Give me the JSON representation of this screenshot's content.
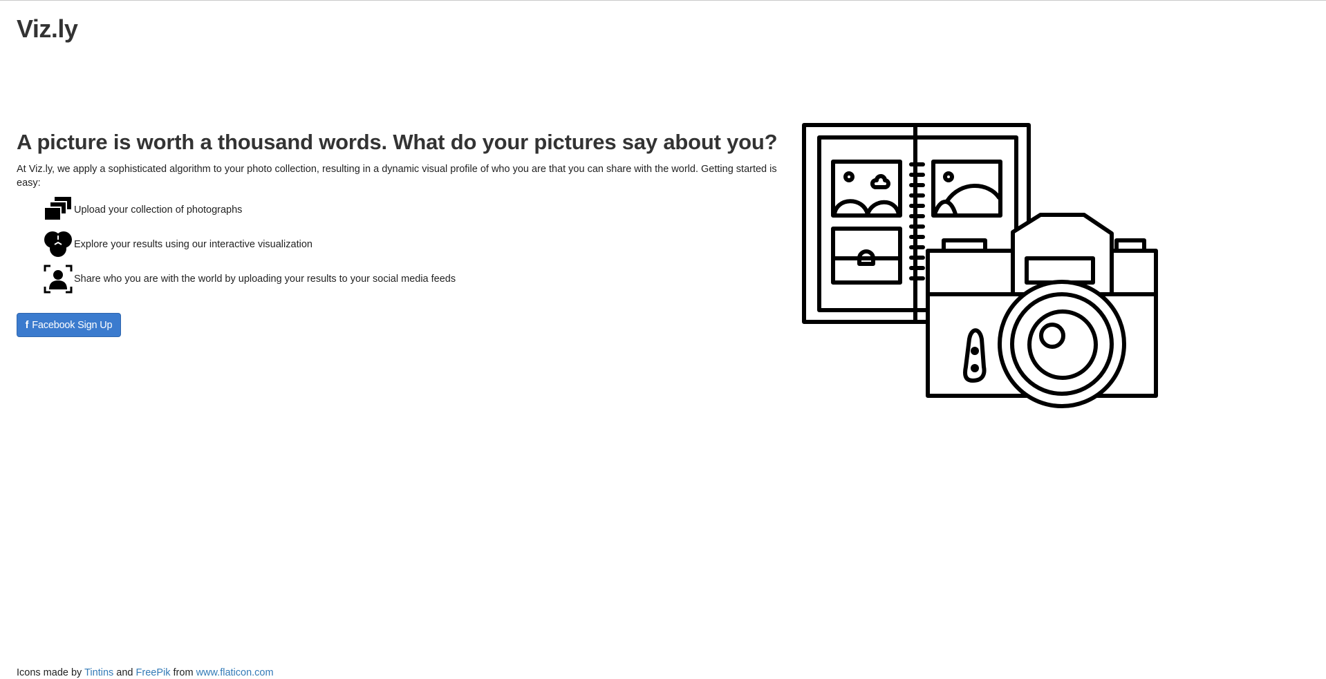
{
  "header": {
    "brand": "Viz.ly"
  },
  "hero": {
    "headline": "A picture is worth a thousand words. What do your pictures say about you?",
    "intro": "At Viz.ly, we apply a sophisticated algorithm to your photo collection, resulting in a dynamic visual profile of who you are that you can share with the world. Getting started is easy:",
    "illustration_icon": "photo-album-camera-icon"
  },
  "steps": [
    {
      "icon": "photos-stack-icon",
      "text": "Upload your collection of photographs"
    },
    {
      "icon": "venn-diagram-icon",
      "text": "Explore your results using our interactive visualization"
    },
    {
      "icon": "user-frame-icon",
      "text": "Share who you are with the world by uploading your results to your social media feeds"
    }
  ],
  "cta": {
    "glyph": "f",
    "label": "Facebook Sign Up",
    "color": "#3b7bce"
  },
  "footer": {
    "prefix": "Icons made by",
    "author1": "Tintins",
    "and": "and",
    "author2": "FreePik",
    "from": "from",
    "site": "www.flaticon.com",
    "link_color": "#337ab7"
  }
}
